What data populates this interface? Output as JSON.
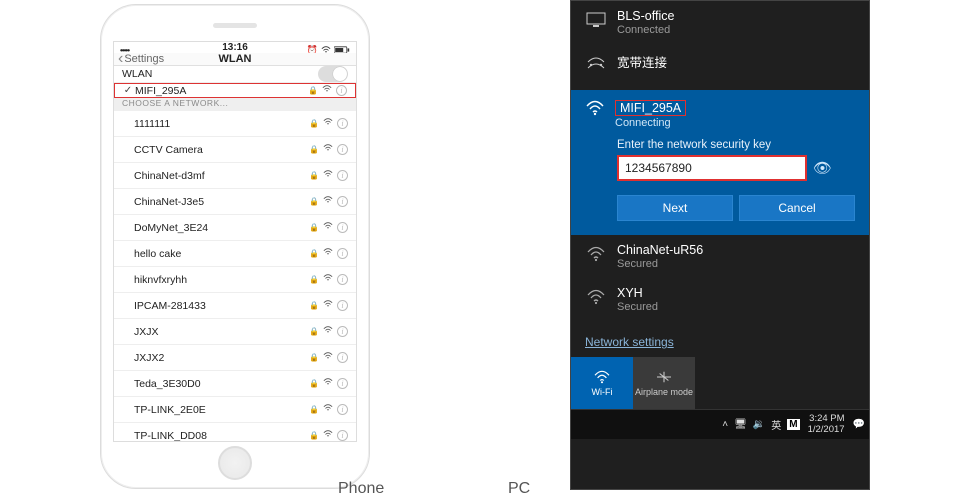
{
  "phone": {
    "status": {
      "time": "13:16",
      "carrier_dots": "•••••"
    },
    "nav": {
      "back": "Settings",
      "title": "WLAN"
    },
    "wlan_toggle_label": "WLAN",
    "connected": {
      "name": "MIFI_295A"
    },
    "section_header": "CHOOSE A NETWORK...",
    "networks": [
      {
        "name": "1111111"
      },
      {
        "name": "CCTV Camera"
      },
      {
        "name": "ChinaNet-d3mf"
      },
      {
        "name": "ChinaNet-J3e5"
      },
      {
        "name": "DoMyNet_3E24"
      },
      {
        "name": "hello cake"
      },
      {
        "name": "hiknvfxryhh"
      },
      {
        "name": "IPCAM-281433"
      },
      {
        "name": "JXJX"
      },
      {
        "name": "JXJX2"
      },
      {
        "name": "Teda_3E30D0"
      },
      {
        "name": "TP-LINK_2E0E"
      },
      {
        "name": "TP-LINK_DD08"
      }
    ]
  },
  "pc": {
    "nets_above": [
      {
        "name": "BLS-office",
        "status": "Connected",
        "icon": "monitor"
      },
      {
        "name": "宽带连接",
        "status": "",
        "icon": "dialup"
      }
    ],
    "active": {
      "name": "MIFI_295A",
      "status": "Connecting",
      "prompt": "Enter the network security key",
      "password": "1234567890",
      "next": "Next",
      "cancel": "Cancel"
    },
    "nets_below": [
      {
        "name": "ChinaNet-uR56",
        "status": "Secured"
      },
      {
        "name": "XYH",
        "status": "Secured"
      }
    ],
    "settings_link": "Network settings",
    "tiles": {
      "wifi": "Wi-Fi",
      "airplane": "Airplane mode"
    },
    "taskbar": {
      "ime1": "英",
      "ime2": "M",
      "time": "3:24 PM",
      "date": "1/2/2017"
    }
  },
  "captions": {
    "phone": "Phone",
    "pc": "PC"
  }
}
